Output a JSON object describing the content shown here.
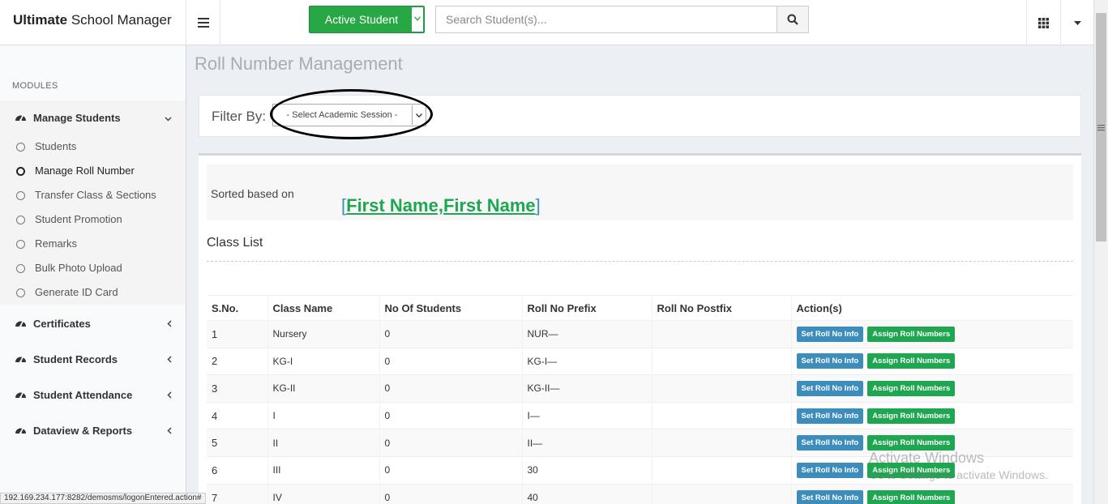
{
  "header": {
    "brand_bold": "Ultimate",
    "brand_rest": "School Manager",
    "active_student_label": "Active Student",
    "search_placeholder": "Search Student(s)..."
  },
  "sidebar": {
    "modules_heading": "MODULES",
    "groups": [
      {
        "label": "Manage Students",
        "icon": "dashboard-icon",
        "expanded": true
      },
      {
        "label": "Certificates",
        "icon": "dashboard-icon",
        "expanded": false
      },
      {
        "label": "Student Records",
        "icon": "dashboard-icon",
        "expanded": false
      },
      {
        "label": "Student Attendance",
        "icon": "dashboard-icon",
        "expanded": false
      },
      {
        "label": "Dataview & Reports",
        "icon": "dashboard-icon",
        "expanded": false
      }
    ],
    "sub_items": [
      {
        "label": "Students"
      },
      {
        "label": "Manage Roll Number",
        "active": true
      },
      {
        "label": "Transfer Class & Sections"
      },
      {
        "label": "Student Promotion"
      },
      {
        "label": "Remarks"
      },
      {
        "label": "Bulk Photo Upload"
      },
      {
        "label": "Generate ID Card"
      }
    ]
  },
  "main": {
    "page_title": "Roll Number Management",
    "filter_label": "Filter By:",
    "session_select": "- Select Academic Session -",
    "sorted_label": "Sorted based on",
    "sorted_value": "First Name,First Name",
    "class_list_title": "Class List",
    "table": {
      "headers": [
        "S.No.",
        "Class Name",
        "No Of Students",
        "Roll No Prefix",
        "Roll No Postfix",
        "Action(s)"
      ],
      "rows": [
        {
          "sno": "1",
          "class": "Nursery",
          "students": "0",
          "prefix": "NUR—",
          "postfix": ""
        },
        {
          "sno": "2",
          "class": "KG-I",
          "students": "0",
          "prefix": "KG-I—",
          "postfix": ""
        },
        {
          "sno": "3",
          "class": "KG-II",
          "students": "0",
          "prefix": "KG-II—",
          "postfix": ""
        },
        {
          "sno": "4",
          "class": "I",
          "students": "0",
          "prefix": "I—",
          "postfix": ""
        },
        {
          "sno": "5",
          "class": "II",
          "students": "0",
          "prefix": "II—",
          "postfix": ""
        },
        {
          "sno": "6",
          "class": "III",
          "students": "0",
          "prefix": "30",
          "postfix": ""
        },
        {
          "sno": "7",
          "class": "IV",
          "students": "0",
          "prefix": "40",
          "postfix": ""
        }
      ],
      "btn_set": "Set Roll No Info",
      "btn_assign": "Assign Roll Numbers"
    }
  },
  "overlay": {
    "watermark_line1": "Activate Windows",
    "watermark_line2": "Go to Settings to activate Windows.",
    "status_url": "192.169.234.177:8282/demosms/logonEntered.action#"
  },
  "colors": {
    "green": "#28a745",
    "blue_button": "#3c8dbc",
    "assign_green": "#1ea650"
  }
}
